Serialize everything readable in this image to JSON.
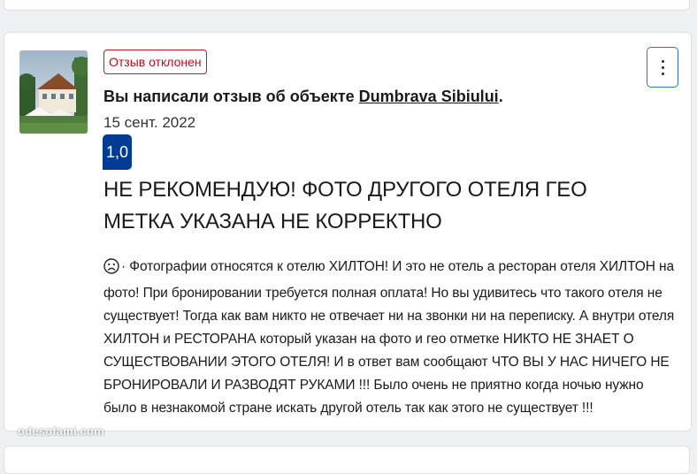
{
  "review": {
    "status": "Отзыв отклонен",
    "headline_prefix": "Вы написали отзыв об объекте ",
    "property_name": "Dumbrava Sibiului",
    "headline_suffix": ".",
    "date": "15 сент. 2022",
    "score": "1,0",
    "title": "НЕ РЕКОМЕНДУЮ! ФОТО ДРУГОГО ОТЕЛЯ ГЕО МЕТКА УКАЗАНА НЕ КОРРЕКТНО",
    "body_separator": "·",
    "body": "Фотографии относятся к отелю ХИЛТОН! И это не отель а ресторан отеля ХИЛТОН на фото! При бронировании требуется полная оплата! Но вы удивитесь что такого отеля не существует! Тогда как вам никто не отвечает ни на звонки ни на переписку. А внутри отеля ХИЛТОН и РЕСТОРАНА который указан на фото и гео отметке НИКТО НЕ ЗНАЕТ О СУЩЕСТВОВАНИИ ЭТОГО ОТЕЛЯ! И в ответ вам сообщают ЧТО ВЫ У НАС НИЧЕГО НЕ БРОНИРОВАЛИ И РАЗВОДЯТ РУКАМИ !!! Было очень не приятно когда ночью нужно было в незнакомой стране искать другой отель так как этого не существует !!!"
  },
  "icons": {
    "menu": "more-vertical-icon",
    "sentiment": "sad-face-icon",
    "thumbnail": "hotel-photo"
  },
  "colors": {
    "status_red": "#d4111e",
    "score_blue": "#003b95",
    "menu_border_blue": "#2f6fd6"
  },
  "watermark": "odesofami.com"
}
